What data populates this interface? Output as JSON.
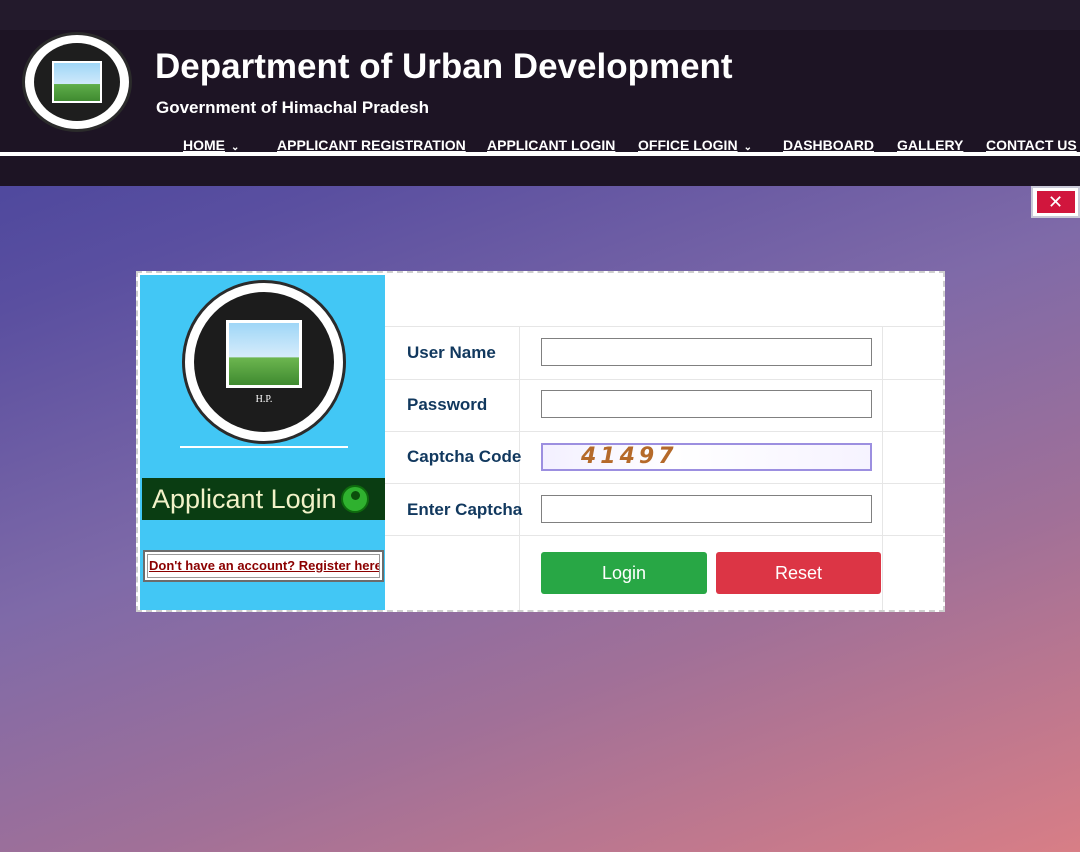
{
  "header": {
    "title": "Department of Urban Development",
    "subtitle": "Government of Himachal Pradesh",
    "logo_icon": "urban-development-department-seal"
  },
  "nav": {
    "items": [
      {
        "label": "HOME",
        "dropdown": true
      },
      {
        "label": "APPLICANT REGISTRATION",
        "dropdown": false
      },
      {
        "label": "APPLICANT LOGIN",
        "dropdown": false
      },
      {
        "label": "OFFICE LOGIN",
        "dropdown": true
      },
      {
        "label": "DASHBOARD",
        "dropdown": false
      },
      {
        "label": "GALLERY",
        "dropdown": false
      },
      {
        "label": "CONTACT US",
        "dropdown": false
      }
    ]
  },
  "close": {
    "icon": "close-icon",
    "glyph": "✕"
  },
  "login_panel": {
    "heading": "Applicant Login",
    "register_link": "Don't have an account? Register here",
    "logo_caption": "H.P."
  },
  "form": {
    "username_label": "User Name",
    "password_label": "Password",
    "captcha_label": "Captcha Code",
    "captcha_value": "41497",
    "enter_captcha_label": "Enter Captcha",
    "username_value": "",
    "password_value": "",
    "enter_captcha_value": "",
    "login_button": "Login",
    "reset_button": "Reset"
  },
  "colors": {
    "header_bg": "#1d1424",
    "panel_bg": "#42c7f5",
    "banner_bg": "#0a3d12",
    "login_btn": "#28a745",
    "reset_btn": "#dc3545",
    "close_btn": "#d1163d",
    "label_color": "#11385e"
  }
}
